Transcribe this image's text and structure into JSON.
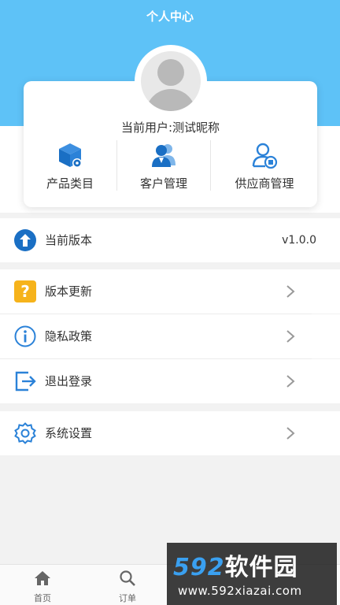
{
  "header": {
    "title": "个人中心"
  },
  "profile": {
    "username": "当前用户:测试昵称"
  },
  "quick_actions": [
    {
      "label": "产品类目",
      "icon": "product-cube-icon"
    },
    {
      "label": "客户管理",
      "icon": "customers-icon"
    },
    {
      "label": "供应商管理",
      "icon": "supplier-icon"
    }
  ],
  "version": {
    "label": "当前版本",
    "value": "v1.0.0",
    "icon": "upload-arrow-icon"
  },
  "menu": [
    {
      "label": "版本更新",
      "icon": "question-icon"
    },
    {
      "label": "隐私政策",
      "icon": "info-icon"
    },
    {
      "label": "退出登录",
      "icon": "logout-icon"
    }
  ],
  "settings": {
    "label": "系统设置",
    "icon": "gear-icon"
  },
  "tabbar": [
    {
      "label": "首页",
      "icon": "home-icon"
    },
    {
      "label": "订单",
      "icon": "search-icon"
    }
  ],
  "watermark": {
    "brand_num": "592",
    "brand_cn": "软件园",
    "url": "www.592xiazai.com"
  },
  "colors": {
    "header": "#5ec2f7",
    "accent": "#1a7ed3",
    "warning": "#f6b31b",
    "background": "#f2f2f2"
  }
}
